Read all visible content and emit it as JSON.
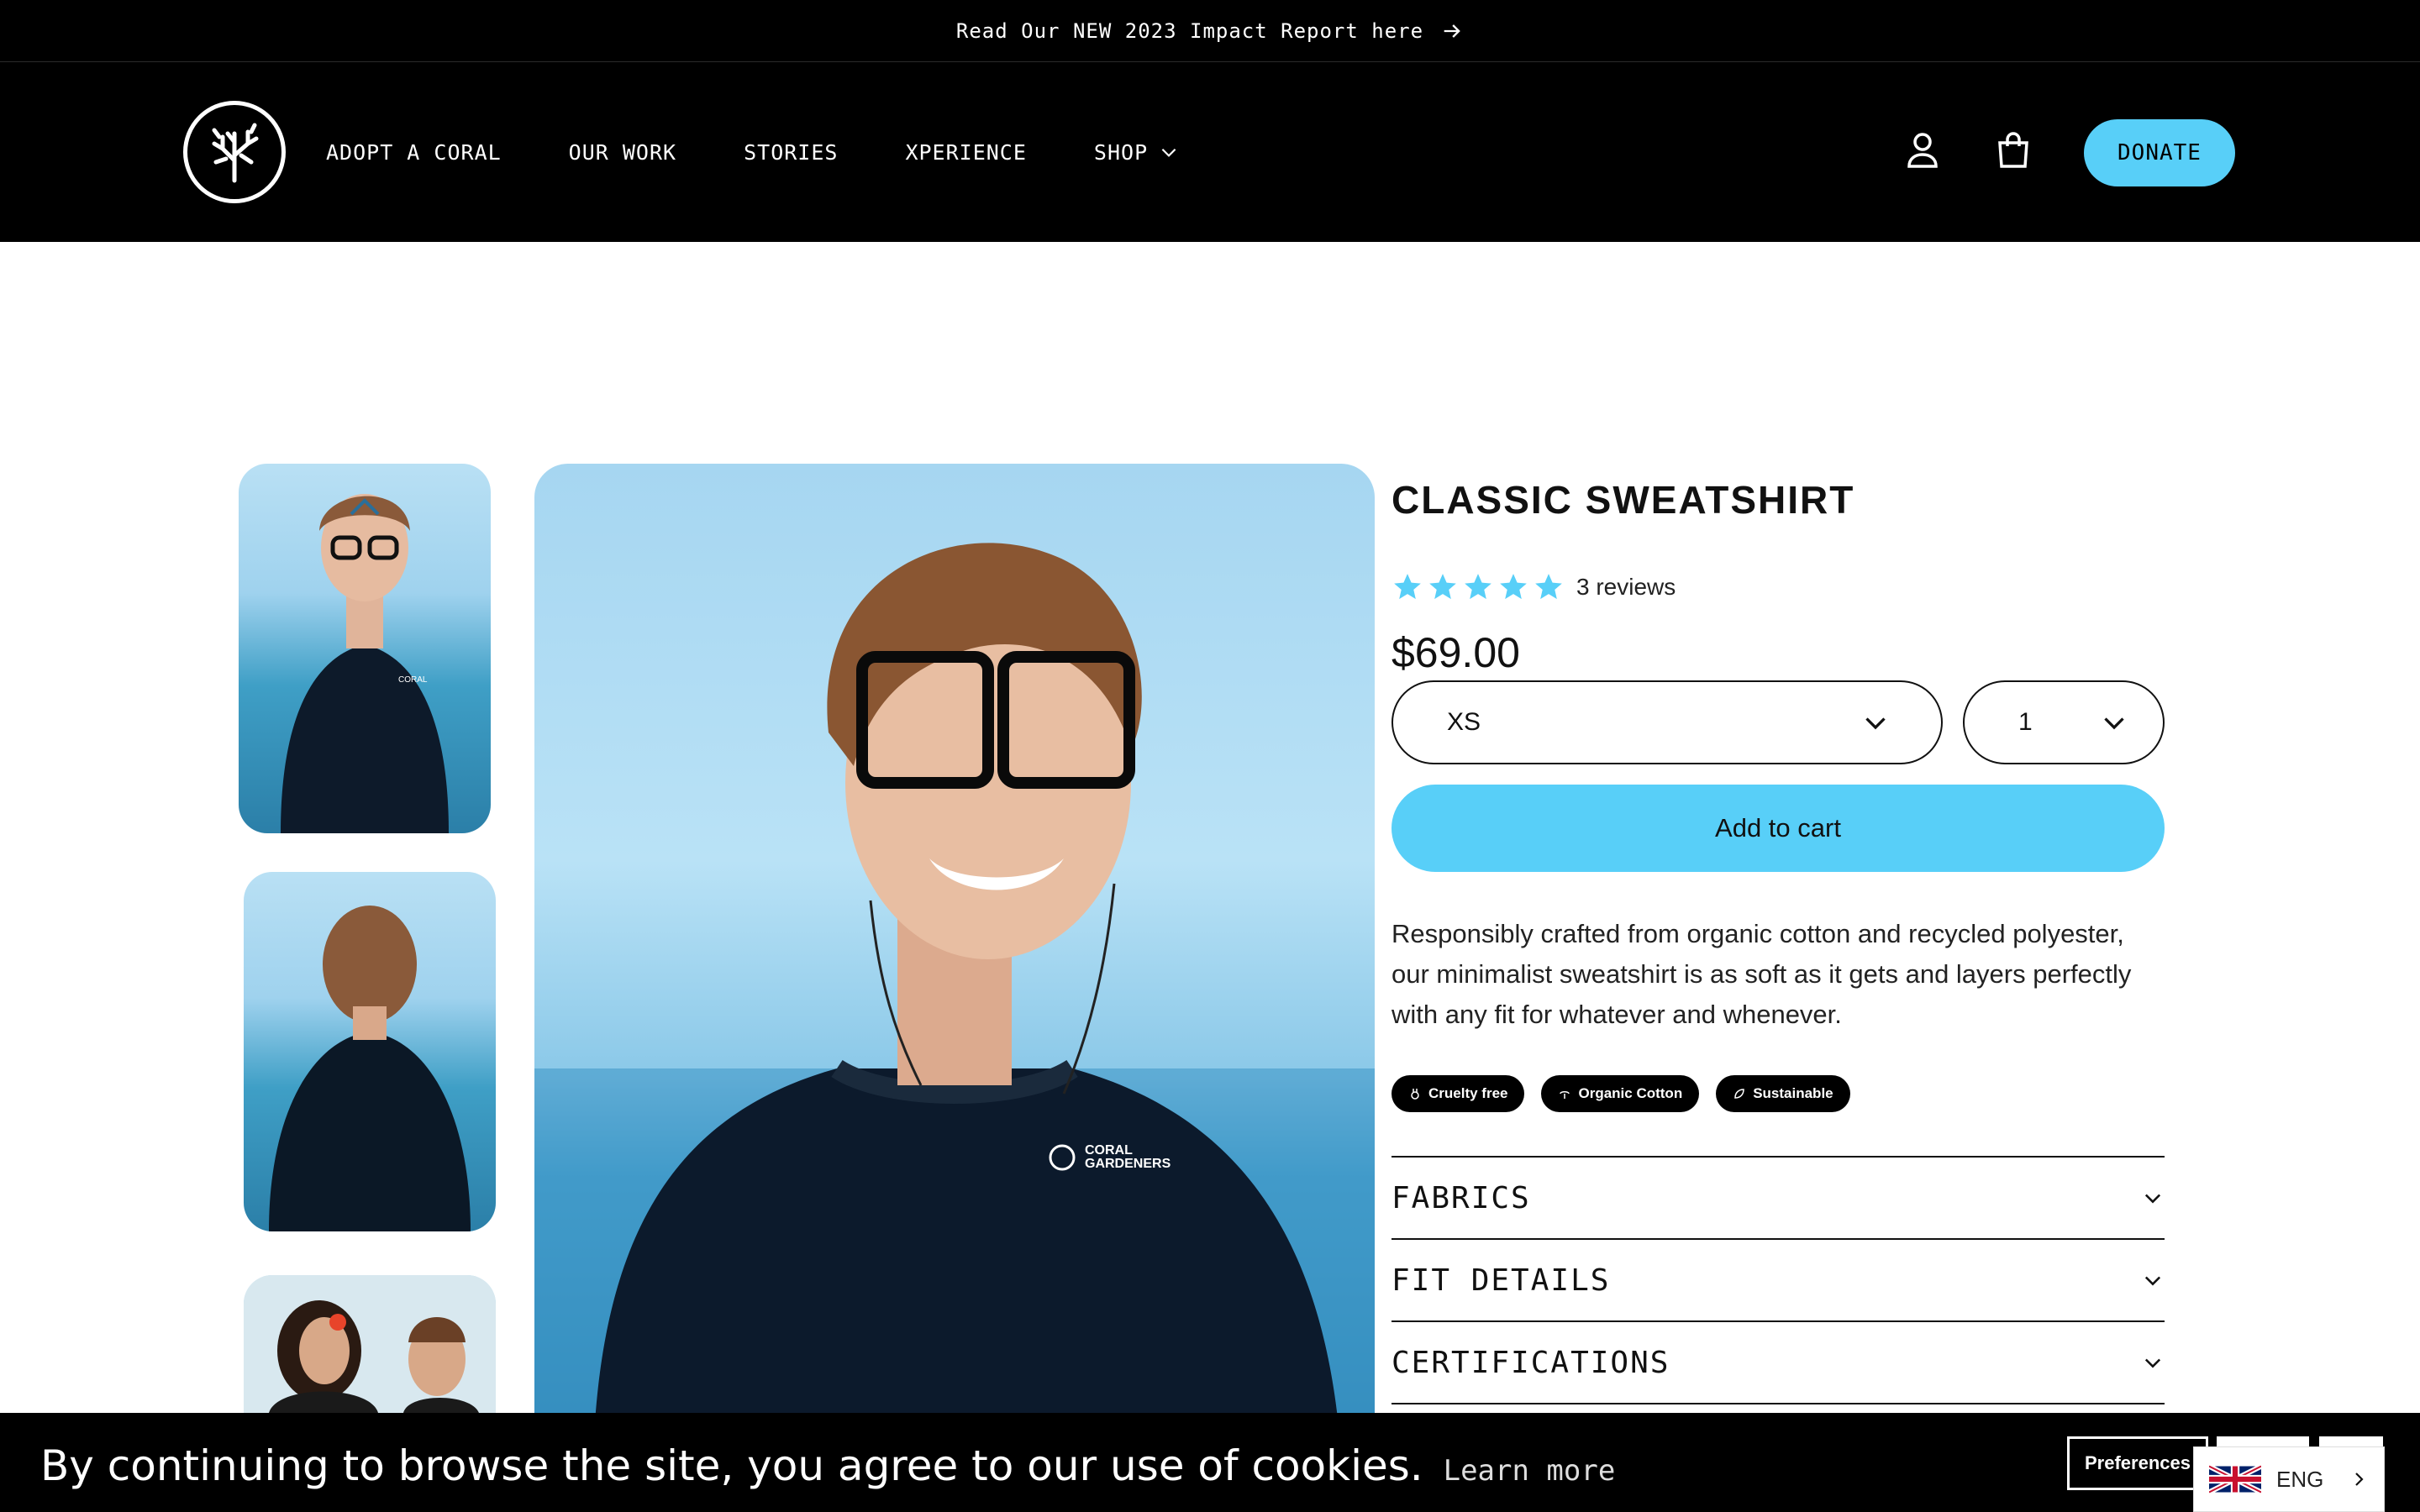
{
  "announcement": {
    "text": "Read Our NEW 2023 Impact Report here",
    "icon": "arrow-right-icon"
  },
  "header": {
    "logo": "coral-logo",
    "nav": [
      {
        "label": "ADOPT A CORAL"
      },
      {
        "label": "OUR WORK"
      },
      {
        "label": "STORIES"
      },
      {
        "label": "XPERIENCE"
      },
      {
        "label": "SHOP",
        "icon": "chevron-down-icon"
      }
    ],
    "account_icon": "user-icon",
    "cart_icon": "shopping-bag-icon",
    "donate_label": "DONATE"
  },
  "product": {
    "title": "CLASSIC SWEATSHIRT",
    "rating": 5,
    "reviews_label": "3 reviews",
    "price": "$69.00",
    "size_selected": "XS",
    "quantity_selected": "1",
    "add_to_cart_label": "Add to cart",
    "description": "Responsibly crafted from organic cotton and recycled polyester, our minimalist sweatshirt is as soft as it gets and layers perfectly with any fit for whatever and whenever.",
    "badges": [
      {
        "label": "Cruelty free",
        "icon": "bunny-icon"
      },
      {
        "label": "Organic Cotton",
        "icon": "cotton-icon"
      },
      {
        "label": "Sustainable",
        "icon": "leaf-icon"
      }
    ],
    "accordions": [
      {
        "label": "FABRICS"
      },
      {
        "label": "FIT DETAILS"
      },
      {
        "label": "CERTIFICATIONS"
      }
    ],
    "shirt_logo": "CORAL GARDENERS"
  },
  "cookie": {
    "text": "By continuing to browse the site, you agree to our use of cookies.",
    "learn_more": "Learn more",
    "preferences_label": "Preferences"
  },
  "language": {
    "label": "ENG",
    "flag": "uk-flag-icon"
  },
  "colors": {
    "accent": "#58cff8",
    "black": "#000000",
    "star": "#58cff8"
  }
}
